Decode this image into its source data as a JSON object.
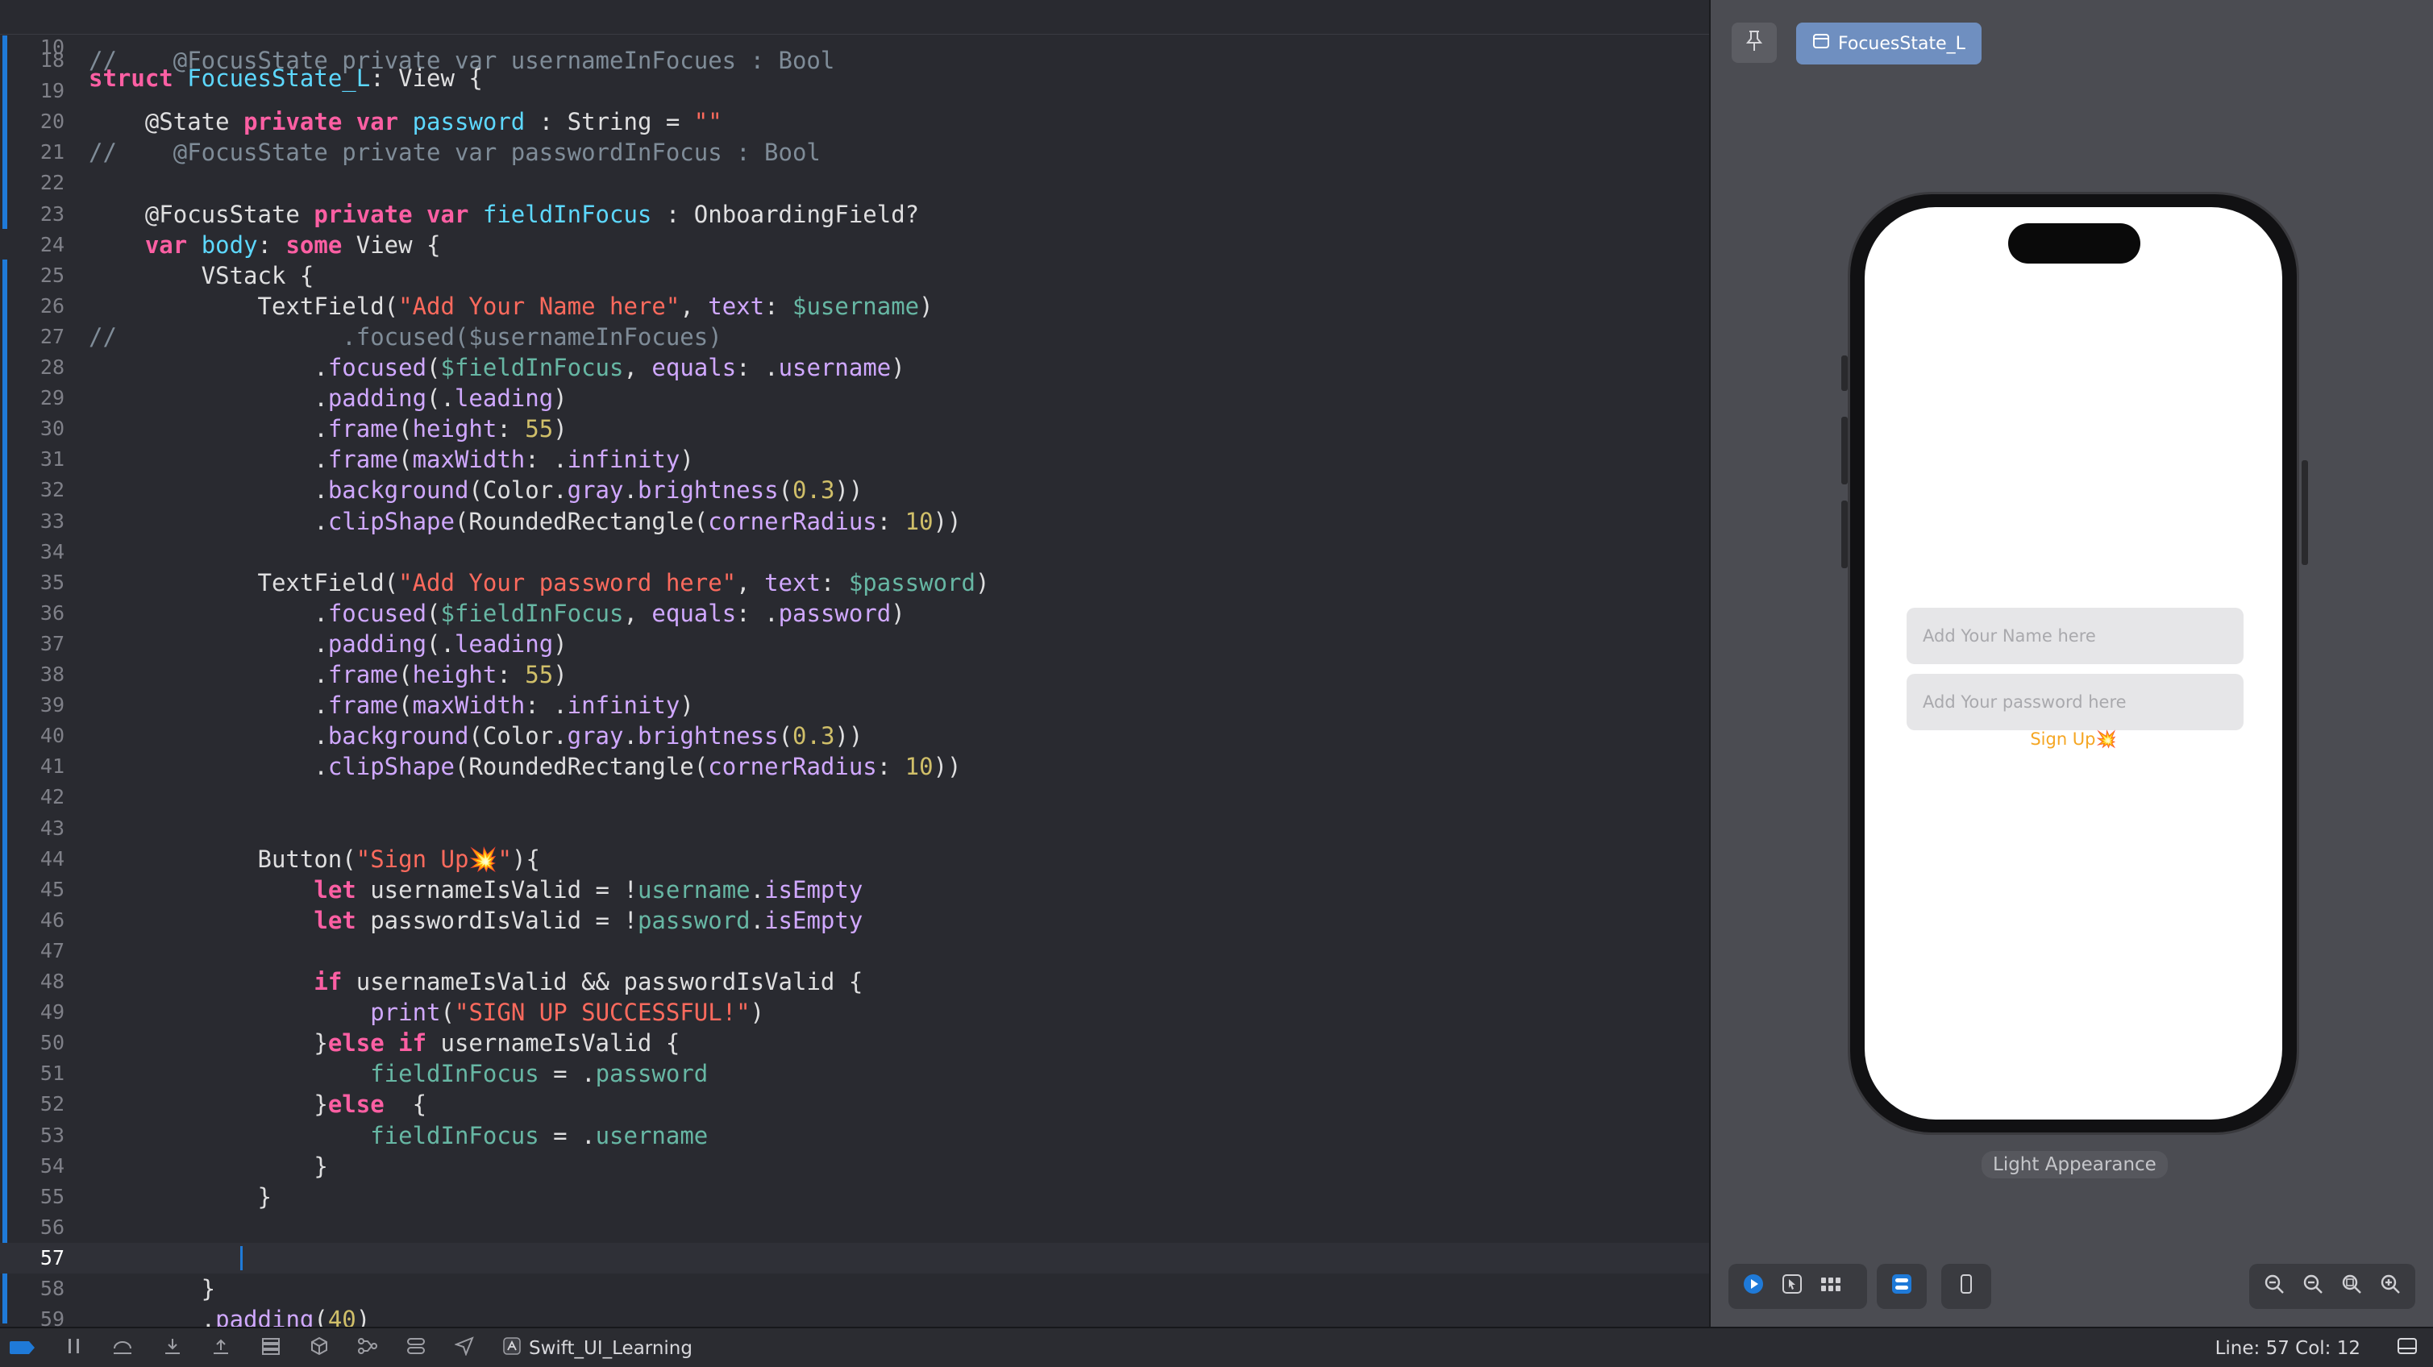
{
  "editor": {
    "sticky": {
      "line": "10",
      "tokens": [
        {
          "t": "struct ",
          "c": "kw"
        },
        {
          "t": "FocuesState_L",
          "c": "tp"
        },
        {
          "t": ": View {",
          "c": ""
        }
      ]
    },
    "current_line": "57",
    "lines": [
      {
        "n": "18",
        "tokens": [
          {
            "t": "//    @FocusState private var usernameInFocues : Bool",
            "c": "cm"
          }
        ]
      },
      {
        "n": "19",
        "tokens": []
      },
      {
        "n": "20",
        "tokens": [
          {
            "t": "    @State ",
            "c": ""
          },
          {
            "t": "private var ",
            "c": "kw"
          },
          {
            "t": "password",
            "c": "tp"
          },
          {
            "t": " : String = ",
            "c": ""
          },
          {
            "t": "\"\"",
            "c": "st"
          }
        ]
      },
      {
        "n": "21",
        "tokens": [
          {
            "t": "//    @FocusState private var passwordInFocus : Bool",
            "c": "cm"
          }
        ]
      },
      {
        "n": "22",
        "tokens": []
      },
      {
        "n": "23",
        "tokens": [
          {
            "t": "    @FocusState ",
            "c": ""
          },
          {
            "t": "private var ",
            "c": "kw"
          },
          {
            "t": "fieldInFocus",
            "c": "tp"
          },
          {
            "t": " : OnboardingField?",
            "c": ""
          }
        ]
      },
      {
        "n": "24",
        "tokens": [
          {
            "t": "    ",
            "c": ""
          },
          {
            "t": "var ",
            "c": "kw"
          },
          {
            "t": "body",
            "c": "tp"
          },
          {
            "t": ": ",
            "c": ""
          },
          {
            "t": "some ",
            "c": "kw"
          },
          {
            "t": "View {",
            "c": ""
          }
        ]
      },
      {
        "n": "25",
        "tokens": [
          {
            "t": "        VStack {",
            "c": ""
          }
        ]
      },
      {
        "n": "26",
        "tokens": [
          {
            "t": "            TextField(",
            "c": ""
          },
          {
            "t": "\"Add Your Name here\"",
            "c": "st"
          },
          {
            "t": ", ",
            "c": ""
          },
          {
            "t": "text",
            "c": "ty"
          },
          {
            "t": ": ",
            "c": ""
          },
          {
            "t": "$username",
            "c": "pr"
          },
          {
            "t": ")",
            "c": ""
          }
        ]
      },
      {
        "n": "27",
        "tokens": [
          {
            "t": "//                .focused($usernameInFocues)",
            "c": "cm"
          }
        ]
      },
      {
        "n": "28",
        "tokens": [
          {
            "t": "                .",
            "c": ""
          },
          {
            "t": "focused",
            "c": "ty"
          },
          {
            "t": "(",
            "c": ""
          },
          {
            "t": "$fieldInFocus",
            "c": "pr"
          },
          {
            "t": ", ",
            "c": ""
          },
          {
            "t": "equals",
            "c": "ty"
          },
          {
            "t": ": .",
            "c": ""
          },
          {
            "t": "username",
            "c": "ty"
          },
          {
            "t": ")",
            "c": ""
          }
        ]
      },
      {
        "n": "29",
        "tokens": [
          {
            "t": "                .",
            "c": ""
          },
          {
            "t": "padding",
            "c": "ty"
          },
          {
            "t": "(.",
            "c": ""
          },
          {
            "t": "leading",
            "c": "ty"
          },
          {
            "t": ")",
            "c": ""
          }
        ]
      },
      {
        "n": "30",
        "tokens": [
          {
            "t": "                .",
            "c": ""
          },
          {
            "t": "frame",
            "c": "ty"
          },
          {
            "t": "(",
            "c": ""
          },
          {
            "t": "height",
            "c": "ty"
          },
          {
            "t": ": ",
            "c": ""
          },
          {
            "t": "55",
            "c": "nu"
          },
          {
            "t": ")",
            "c": ""
          }
        ]
      },
      {
        "n": "31",
        "tokens": [
          {
            "t": "                .",
            "c": ""
          },
          {
            "t": "frame",
            "c": "ty"
          },
          {
            "t": "(",
            "c": ""
          },
          {
            "t": "maxWidth",
            "c": "ty"
          },
          {
            "t": ": .",
            "c": ""
          },
          {
            "t": "infinity",
            "c": "ty"
          },
          {
            "t": ")",
            "c": ""
          }
        ]
      },
      {
        "n": "32",
        "tokens": [
          {
            "t": "                .",
            "c": ""
          },
          {
            "t": "background",
            "c": "ty"
          },
          {
            "t": "(Color.",
            "c": ""
          },
          {
            "t": "gray",
            "c": "ty"
          },
          {
            "t": ".",
            "c": ""
          },
          {
            "t": "brightness",
            "c": "ty"
          },
          {
            "t": "(",
            "c": ""
          },
          {
            "t": "0.3",
            "c": "nu"
          },
          {
            "t": "))",
            "c": ""
          }
        ]
      },
      {
        "n": "33",
        "tokens": [
          {
            "t": "                .",
            "c": ""
          },
          {
            "t": "clipShape",
            "c": "ty"
          },
          {
            "t": "(RoundedRectangle(",
            "c": ""
          },
          {
            "t": "cornerRadius",
            "c": "ty"
          },
          {
            "t": ": ",
            "c": ""
          },
          {
            "t": "10",
            "c": "nu"
          },
          {
            "t": "))",
            "c": ""
          }
        ]
      },
      {
        "n": "34",
        "tokens": []
      },
      {
        "n": "35",
        "tokens": [
          {
            "t": "            TextField(",
            "c": ""
          },
          {
            "t": "\"Add Your password here\"",
            "c": "st"
          },
          {
            "t": ", ",
            "c": ""
          },
          {
            "t": "text",
            "c": "ty"
          },
          {
            "t": ": ",
            "c": ""
          },
          {
            "t": "$password",
            "c": "pr"
          },
          {
            "t": ")",
            "c": ""
          }
        ]
      },
      {
        "n": "36",
        "tokens": [
          {
            "t": "                .",
            "c": ""
          },
          {
            "t": "focused",
            "c": "ty"
          },
          {
            "t": "(",
            "c": ""
          },
          {
            "t": "$fieldInFocus",
            "c": "pr"
          },
          {
            "t": ", ",
            "c": ""
          },
          {
            "t": "equals",
            "c": "ty"
          },
          {
            "t": ": .",
            "c": ""
          },
          {
            "t": "password",
            "c": "ty"
          },
          {
            "t": ")",
            "c": ""
          }
        ]
      },
      {
        "n": "37",
        "tokens": [
          {
            "t": "                .",
            "c": ""
          },
          {
            "t": "padding",
            "c": "ty"
          },
          {
            "t": "(.",
            "c": ""
          },
          {
            "t": "leading",
            "c": "ty"
          },
          {
            "t": ")",
            "c": ""
          }
        ]
      },
      {
        "n": "38",
        "tokens": [
          {
            "t": "                .",
            "c": ""
          },
          {
            "t": "frame",
            "c": "ty"
          },
          {
            "t": "(",
            "c": ""
          },
          {
            "t": "height",
            "c": "ty"
          },
          {
            "t": ": ",
            "c": ""
          },
          {
            "t": "55",
            "c": "nu"
          },
          {
            "t": ")",
            "c": ""
          }
        ]
      },
      {
        "n": "39",
        "tokens": [
          {
            "t": "                .",
            "c": ""
          },
          {
            "t": "frame",
            "c": "ty"
          },
          {
            "t": "(",
            "c": ""
          },
          {
            "t": "maxWidth",
            "c": "ty"
          },
          {
            "t": ": .",
            "c": ""
          },
          {
            "t": "infinity",
            "c": "ty"
          },
          {
            "t": ")",
            "c": ""
          }
        ]
      },
      {
        "n": "40",
        "tokens": [
          {
            "t": "                .",
            "c": ""
          },
          {
            "t": "background",
            "c": "ty"
          },
          {
            "t": "(Color.",
            "c": ""
          },
          {
            "t": "gray",
            "c": "ty"
          },
          {
            "t": ".",
            "c": ""
          },
          {
            "t": "brightness",
            "c": "ty"
          },
          {
            "t": "(",
            "c": ""
          },
          {
            "t": "0.3",
            "c": "nu"
          },
          {
            "t": "))",
            "c": ""
          }
        ]
      },
      {
        "n": "41",
        "tokens": [
          {
            "t": "                .",
            "c": ""
          },
          {
            "t": "clipShape",
            "c": "ty"
          },
          {
            "t": "(RoundedRectangle(",
            "c": ""
          },
          {
            "t": "cornerRadius",
            "c": "ty"
          },
          {
            "t": ": ",
            "c": ""
          },
          {
            "t": "10",
            "c": "nu"
          },
          {
            "t": "))",
            "c": ""
          }
        ]
      },
      {
        "n": "42",
        "tokens": []
      },
      {
        "n": "43",
        "tokens": []
      },
      {
        "n": "44",
        "tokens": [
          {
            "t": "            Button(",
            "c": ""
          },
          {
            "t": "\"Sign Up💥\"",
            "c": "st"
          },
          {
            "t": "){",
            "c": ""
          }
        ]
      },
      {
        "n": "45",
        "tokens": [
          {
            "t": "                ",
            "c": ""
          },
          {
            "t": "let ",
            "c": "kw"
          },
          {
            "t": "usernameIsValid = !",
            "c": ""
          },
          {
            "t": "username",
            "c": "pr"
          },
          {
            "t": ".",
            "c": ""
          },
          {
            "t": "isEmpty",
            "c": "ty"
          }
        ]
      },
      {
        "n": "46",
        "tokens": [
          {
            "t": "                ",
            "c": ""
          },
          {
            "t": "let ",
            "c": "kw"
          },
          {
            "t": "passwordIsValid = !",
            "c": ""
          },
          {
            "t": "password",
            "c": "pr"
          },
          {
            "t": ".",
            "c": ""
          },
          {
            "t": "isEmpty",
            "c": "ty"
          }
        ]
      },
      {
        "n": "47",
        "tokens": []
      },
      {
        "n": "48",
        "tokens": [
          {
            "t": "                ",
            "c": ""
          },
          {
            "t": "if ",
            "c": "kw"
          },
          {
            "t": "usernameIsValid && passwordIsValid {",
            "c": ""
          }
        ]
      },
      {
        "n": "49",
        "tokens": [
          {
            "t": "                    ",
            "c": ""
          },
          {
            "t": "print",
            "c": "ty"
          },
          {
            "t": "(",
            "c": ""
          },
          {
            "t": "\"SIGN UP SUCCESSFUL!\"",
            "c": "st"
          },
          {
            "t": ")",
            "c": ""
          }
        ]
      },
      {
        "n": "50",
        "tokens": [
          {
            "t": "                }",
            "c": ""
          },
          {
            "t": "else if ",
            "c": "kw"
          },
          {
            "t": "usernameIsValid {",
            "c": ""
          }
        ]
      },
      {
        "n": "51",
        "tokens": [
          {
            "t": "                    ",
            "c": ""
          },
          {
            "t": "fieldInFocus",
            "c": "pr"
          },
          {
            "t": " = .",
            "c": ""
          },
          {
            "t": "password",
            "c": "pr"
          }
        ]
      },
      {
        "n": "52",
        "tokens": [
          {
            "t": "                }",
            "c": ""
          },
          {
            "t": "else ",
            "c": "kw"
          },
          {
            "t": " {",
            "c": ""
          }
        ]
      },
      {
        "n": "53",
        "tokens": [
          {
            "t": "                    ",
            "c": ""
          },
          {
            "t": "fieldInFocus",
            "c": "pr"
          },
          {
            "t": " = .",
            "c": ""
          },
          {
            "t": "username",
            "c": "pr"
          }
        ]
      },
      {
        "n": "54",
        "tokens": [
          {
            "t": "                }",
            "c": ""
          }
        ]
      },
      {
        "n": "55",
        "tokens": [
          {
            "t": "            }",
            "c": ""
          }
        ]
      },
      {
        "n": "56",
        "tokens": []
      },
      {
        "n": "57",
        "tokens": []
      },
      {
        "n": "58",
        "tokens": [
          {
            "t": "        }",
            "c": ""
          }
        ]
      },
      {
        "n": "59",
        "tokens": [
          {
            "t": "        .",
            "c": ""
          },
          {
            "t": "padding",
            "c": "ty"
          },
          {
            "t": "(",
            "c": ""
          },
          {
            "t": "40",
            "c": "nu"
          },
          {
            "t": ")",
            "c": ""
          }
        ]
      }
    ]
  },
  "canvas": {
    "pin_icon": "pin-icon",
    "preview_tab_label": "FocuesState_L",
    "appearance_label": "Light Appearance",
    "simulator": {
      "name_placeholder": "Add Your Name here",
      "password_placeholder": "Add Your password here",
      "signup_label": "Sign Up💥"
    }
  },
  "statusbar": {
    "project_name": "Swift_UI_Learning",
    "position": "Line: 57  Col: 12"
  },
  "colors": {
    "accent": "#1f7ad8",
    "signup": "#f5a623",
    "keyword": "#fc5fa3",
    "string": "#fc6a5d"
  }
}
